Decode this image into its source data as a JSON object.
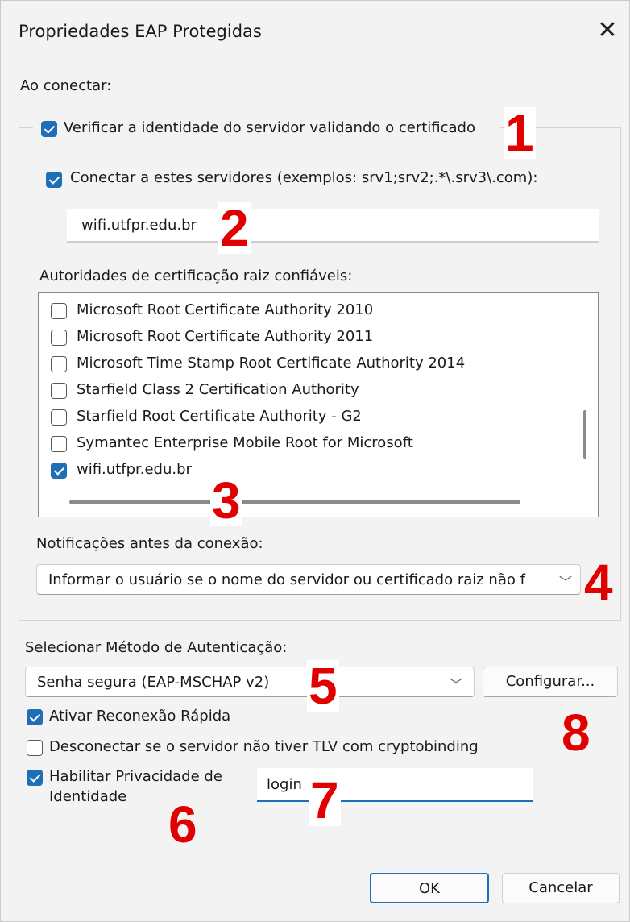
{
  "window": {
    "title": "Propriedades EAP Protegidas",
    "close_glyph": "✕"
  },
  "on_connect_label": "Ao conectar:",
  "verify_server": {
    "label": "Verificar a identidade do servidor validando o certificado",
    "checked": true
  },
  "connect_servers": {
    "label": "Conectar a estes servidores (exemplos: srv1;srv2;.*\\.srv3\\.com):",
    "checked": true,
    "value": "wifi.utfpr.edu.br"
  },
  "trusted_ca": {
    "label": "Autoridades de certificação raiz confiáveis:",
    "items": [
      {
        "label": "Microsoft Root Certificate Authority 2010",
        "checked": false
      },
      {
        "label": "Microsoft Root Certificate Authority 2011",
        "checked": false
      },
      {
        "label": "Microsoft Time Stamp Root Certificate Authority 2014",
        "checked": false
      },
      {
        "label": "Starfield Class 2 Certification Authority",
        "checked": false
      },
      {
        "label": "Starfield Root Certificate Authority - G2",
        "checked": false
      },
      {
        "label": "Symantec Enterprise Mobile Root for Microsoft",
        "checked": false
      },
      {
        "label": "wifi.utfpr.edu.br",
        "checked": true
      }
    ]
  },
  "notifications": {
    "label": "Notificações antes da conexão:",
    "selected": "Informar o usuário se o nome do servidor ou certificado raiz não f"
  },
  "auth_method": {
    "label": "Selecionar Método de Autenticação:",
    "selected": "Senha segura (EAP-MSCHAP v2)",
    "configure_button": "Configurar..."
  },
  "fast_reconnect": {
    "label": "Ativar Reconexão Rápida",
    "checked": true
  },
  "disconnect_tlv": {
    "label": "Desconectar se o servidor não tiver TLV com cryptobinding",
    "checked": false
  },
  "identity_privacy": {
    "label_line1": "Habilitar Privacidade de",
    "label_line2": "Identidade",
    "checked": true,
    "value": "login"
  },
  "buttons": {
    "ok": "OK",
    "cancel": "Cancelar"
  },
  "annotations": [
    "1",
    "2",
    "3",
    "4",
    "5",
    "6",
    "7",
    "8"
  ],
  "colors": {
    "accent": "#1f6fb8",
    "annotation": "#e00000",
    "background": "#f3f3f3"
  }
}
